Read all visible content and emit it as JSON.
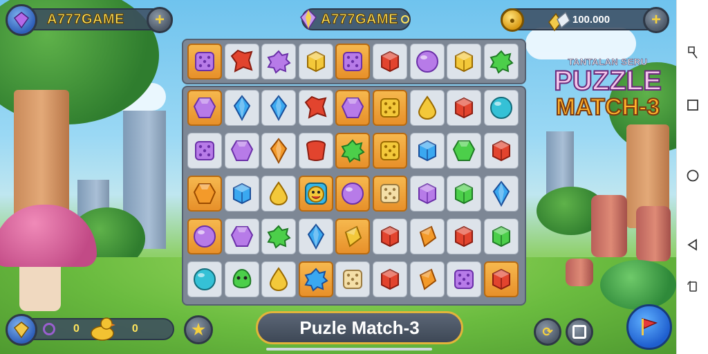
{
  "top_bar": {
    "left_title": "A777GAME",
    "center_title": "A777GAME",
    "coins": "100.000"
  },
  "title_logo": {
    "subtitle": "TANTALAN SERU",
    "line1": "PUZZLE",
    "line2": "MATCH-3"
  },
  "bottom_bar": {
    "left_count_a": "0",
    "left_count_b": "0",
    "title": "Puzle Match-3"
  },
  "board": {
    "top_row": [
      "purple-die",
      "red-star",
      "purple-splat",
      "yellow-cube",
      "purple-die-light",
      "red-cube",
      "purple-orb",
      "yellow-cube",
      "green-splat"
    ],
    "rows": [
      [
        "purple-gem",
        "blue-crystal",
        "blue-crystal",
        "red-star",
        "purple-gem",
        "yellow-die",
        "yellow-drop",
        "red-cube",
        "teal-orb"
      ],
      [
        "purple-die",
        "purple-gem",
        "orange-crystal",
        "red-cup",
        "green-splat",
        "yellow-die",
        "blue-cube",
        "green-gem",
        "red-cube"
      ],
      [
        "orange-gem",
        "blue-cube",
        "yellow-drop",
        "smiley-face",
        "purple-orb",
        "cream-die",
        "purple-cube",
        "green-cube",
        "blue-crystal"
      ],
      [
        "purple-orb",
        "purple-gem",
        "green-splat",
        "blue-crystal",
        "yellow-diamond",
        "red-cube",
        "orange-diamond",
        "red-cube",
        "green-cube"
      ],
      [
        "teal-orb",
        "green-blob",
        "yellow-drop",
        "blue-splat",
        "cream-die",
        "red-cube",
        "orange-diamond",
        "purple-die",
        "red-cube"
      ]
    ],
    "highlighted": [
      {
        "row": 0,
        "col": 0
      },
      {
        "row": 0,
        "col": 4
      },
      {
        "row": 0,
        "col": 5
      },
      {
        "row": 1,
        "col": 4
      },
      {
        "row": 1,
        "col": 5
      },
      {
        "row": 2,
        "col": 0
      },
      {
        "row": 2,
        "col": 3
      },
      {
        "row": 2,
        "col": 4
      },
      {
        "row": 2,
        "col": 5
      },
      {
        "row": 3,
        "col": 0
      },
      {
        "row": 3,
        "col": 4
      },
      {
        "row": 4,
        "col": 3
      },
      {
        "row": 4,
        "col": 8
      }
    ]
  },
  "colors": {
    "gold": "#ffe45c",
    "board": "#7d8795",
    "highlight_orange": "#f2a23a",
    "highlight_teal": "#5fc6e8"
  },
  "navbar_icons": [
    "screenshot-icon",
    "square-icon",
    "circle-home-icon",
    "back-triangle-icon",
    "rotate-icon"
  ]
}
